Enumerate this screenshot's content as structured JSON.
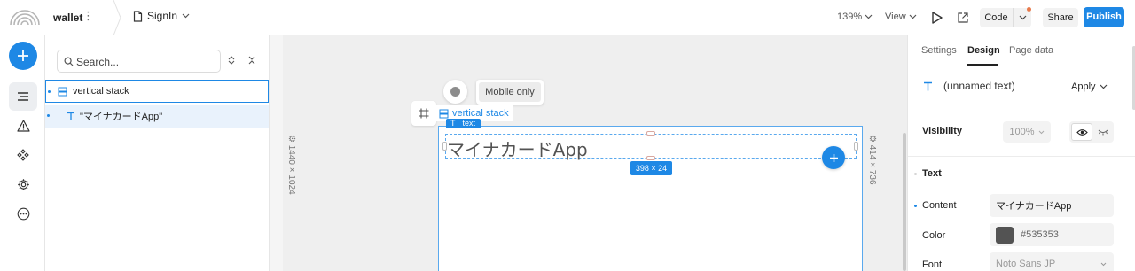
{
  "header": {
    "project_name": "wallet",
    "page_name": "SignIn",
    "zoom": "139%",
    "view_label": "View",
    "code_label": "Code",
    "share_label": "Share",
    "publish_label": "Publish"
  },
  "layers": {
    "search_placeholder": "Search...",
    "items": [
      {
        "label": "vertical stack",
        "icon": "stack-icon"
      },
      {
        "label": "\"マイナカードApp\"",
        "icon": "text-icon"
      }
    ]
  },
  "canvas": {
    "mobile_only_label": "Mobile only",
    "stack_label": "vertical stack",
    "text_tag": "text",
    "text_content": "マイナカードApp",
    "size_badge": "398 × 24",
    "breakpoint_left": "1440 × 1024",
    "breakpoint_right": "414 × 736"
  },
  "props": {
    "tabs": [
      "Settings",
      "Design",
      "Page data"
    ],
    "active_tab": "Design",
    "node_name": "(unnamed text)",
    "apply_label": "Apply",
    "visibility_label": "Visibility",
    "opacity": "100%",
    "text_section": "Text",
    "content_label": "Content",
    "content_value": "マイナカードApp",
    "color_label": "Color",
    "color_value": "#535353",
    "font_label": "Font",
    "font_value": "Noto Sans JP"
  },
  "colors": {
    "accent": "#1e88e5",
    "text_color": "#535353"
  }
}
